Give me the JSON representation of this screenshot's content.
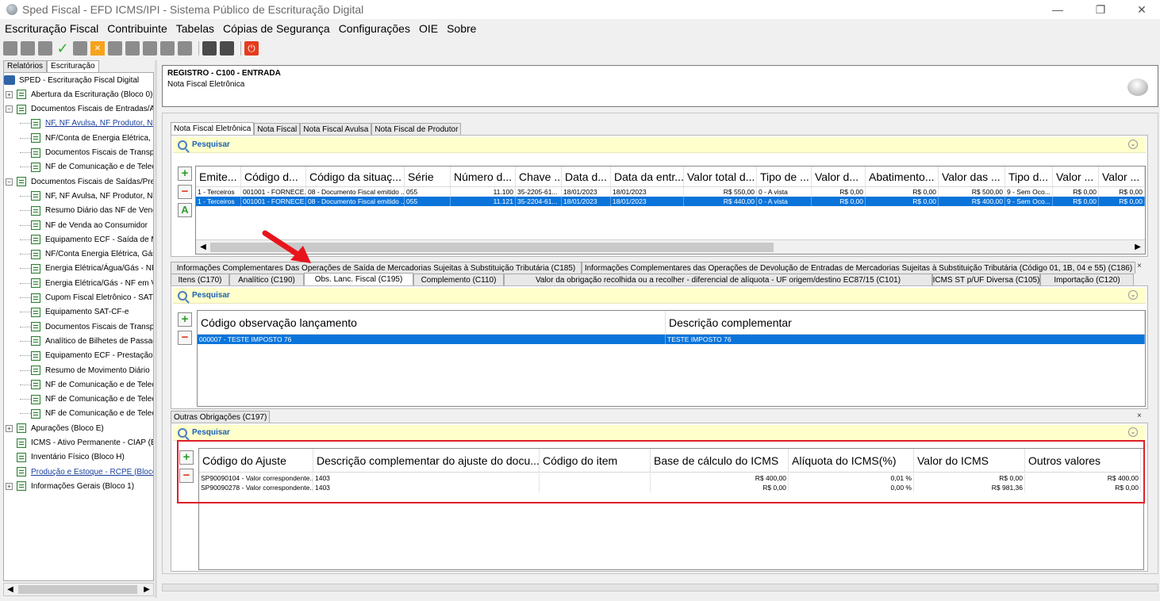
{
  "window": {
    "title": "Sped Fiscal - EFD ICMS/IPI - Sistema Público de Escrituração Digital",
    "minimize": "—",
    "maximize": "❐",
    "close": "✕"
  },
  "menu": [
    "Escrituração Fiscal",
    "Contribuinte",
    "Tabelas",
    "Cópias de Segurança",
    "Configurações",
    "OIE",
    "Sobre"
  ],
  "left": {
    "tabs": [
      "Relatórios",
      "Escrituração"
    ],
    "tree": [
      {
        "label": "SPED - Escrituração Fiscal Digital",
        "level": 0,
        "icon": "books-icon",
        "exp": ""
      },
      {
        "label": "Abertura da Escrituração (Bloco 0)",
        "level": 1,
        "exp": "+"
      },
      {
        "label": "Documentos Fiscais de Entradas/Aquisi",
        "level": 1,
        "exp": "−"
      },
      {
        "label": "NF, NF Avulsa, NF Produtor, NF-e",
        "level": 2,
        "link": true
      },
      {
        "label": "NF/Conta de Energia Elétrica, Gás e",
        "level": 2
      },
      {
        "label": "Documentos Fiscais de Transportes",
        "level": 2
      },
      {
        "label": "NF de Comunicação e de Telecomur",
        "level": 2
      },
      {
        "label": "Documentos Fiscais de Saídas/Prestaç",
        "level": 1,
        "exp": "−"
      },
      {
        "label": "NF, NF Avulsa, NF Produtor, NF-e, N",
        "level": 2
      },
      {
        "label": "Resumo Diário das NF de Venda a C",
        "level": 2
      },
      {
        "label": "NF de Venda ao Consumidor",
        "level": 2
      },
      {
        "label": "Equipamento ECF - Saída de Mercac",
        "level": 2
      },
      {
        "label": "NF/Conta Energia Elétrica, Gás e Ág",
        "level": 2
      },
      {
        "label": "Energia Elétrica/Água/Gás - NF con",
        "level": 2
      },
      {
        "label": "Energia Elétrica/Gás - NF em Via Ún",
        "level": 2
      },
      {
        "label": "Cupom Fiscal Eletrônico - SAT",
        "level": 2
      },
      {
        "label": "Equipamento SAT-CF-e",
        "level": 2
      },
      {
        "label": "Documentos Fiscais de Transportes",
        "level": 2
      },
      {
        "label": "Analítico de Bilhetes de Passagem",
        "level": 2
      },
      {
        "label": "Equipamento ECF - Prestação de Se",
        "level": 2
      },
      {
        "label": "Resumo de Movimento Diário",
        "level": 2
      },
      {
        "label": "NF de Comunicação e de Telecomur",
        "level": 2
      },
      {
        "label": "NF de Comunicação e de Telecomur",
        "level": 2
      },
      {
        "label": "NF de Comunicação e de Telecomur",
        "level": 2
      },
      {
        "label": "Apurações (Bloco E)",
        "level": 1,
        "exp": "+"
      },
      {
        "label": "ICMS - Ativo Permanente - CIAP (Bloco",
        "level": 1
      },
      {
        "label": "Inventário Físico (Bloco H)",
        "level": 1
      },
      {
        "label": "Produção e Estoque - RCPE (Bloco K)",
        "level": 1,
        "link": true
      },
      {
        "label": "Informações Gerais (Bloco 1)",
        "level": 1,
        "exp": "+"
      }
    ]
  },
  "header": {
    "title": "REGISTRO - C100 - ENTRADA",
    "subtitle": "Nota Fiscal Eletrônica"
  },
  "top_tabs": [
    "Nota Fiscal Eletrônica",
    "Nota Fiscal",
    "Nota Fiscal Avulsa",
    "Nota Fiscal de Produtor"
  ],
  "search_label": "Pesquisar",
  "c100_grid": {
    "columns": [
      "Emite...",
      "Código d...",
      "Código da situaç...",
      "Série",
      "Número d...",
      "Chave ...",
      "Data d...",
      "Data da entr...",
      "Valor total d...",
      "Tipo de ...",
      "Valor d...",
      "Abatimento...",
      "Valor das ...",
      "Tipo d...",
      "Valor ...",
      "Valor ..."
    ],
    "rows": [
      [
        "1 - Terceiros",
        "001001 - FORNECE...",
        "08 - Documento Fiscal emitido ...",
        "055",
        "11.100",
        "35-2205-61...",
        "18/01/2023",
        "18/01/2023",
        "R$ 550,00",
        "0 - A vista",
        "R$ 0,00",
        "R$ 0,00",
        "R$ 500,00",
        "9 - Sem Oco...",
        "R$ 0,00",
        "R$ 0,00"
      ],
      [
        "1 - Terceiros",
        "001001 - FORNECE...",
        "08 - Documento Fiscal emitido ...",
        "055",
        "11.121",
        "35-2204-61...",
        "18/01/2023",
        "18/01/2023",
        "R$ 440,00",
        "0 - A vista",
        "R$ 0,00",
        "R$ 0,00",
        "R$ 400,00",
        "9 - Sem Oco...",
        "R$ 0,00",
        "R$ 0,00"
      ]
    ]
  },
  "mid_tabs_row1": [
    "Informações Complementares Das Operações de Saída de Mercadorias Sujeitas à Substituição Tributária (C185)",
    "Informações Complementares das Operações de Devolução de Entradas de Mercadorias Sujeitas à Substituição Tributária (Código 01, 1B, 04 e 55) (C186)"
  ],
  "mid_tabs_row2": [
    "Itens (C170)",
    "Analítico (C190)",
    "Obs. Lanc. Fiscal (C195)",
    "Complemento (C110)",
    "Valor da obrigação recolhida ou a recolher - diferencial de alíquota - UF origem/destino EC87/15 (C101)",
    "ICMS ST p/UF Diversa (C105)",
    "Importação (C120)"
  ],
  "c195_grid": {
    "columns": [
      "Código observação lançamento",
      "Descrição complementar"
    ],
    "rows": [
      [
        "000007 - TESTE IMPOSTO 76",
        "TESTE IMPOSTO 76"
      ]
    ]
  },
  "c197_tab": "Outras Obrigações (C197)",
  "c197_grid": {
    "columns": [
      "Código do Ajuste",
      "Descrição complementar do ajuste do docu...",
      "Código do item",
      "Base de cálculo do ICMS",
      "Alíquota do ICMS(%)",
      "Valor do ICMS",
      "Outros valores"
    ],
    "rows": [
      [
        "SP90090104 - Valor correspondente...",
        "1403",
        "",
        "R$ 400,00",
        "0,01 %",
        "R$ 0,00",
        "R$ 400,00"
      ],
      [
        "SP90090278 - Valor correspondente...",
        "1403",
        "",
        "R$ 0,00",
        "0,00 %",
        "R$ 981,36",
        "R$ 0,00"
      ]
    ]
  },
  "colors": {
    "selection": "#0a74da",
    "search_bg": "#ffffcc",
    "highlight": "#e01e2a"
  }
}
